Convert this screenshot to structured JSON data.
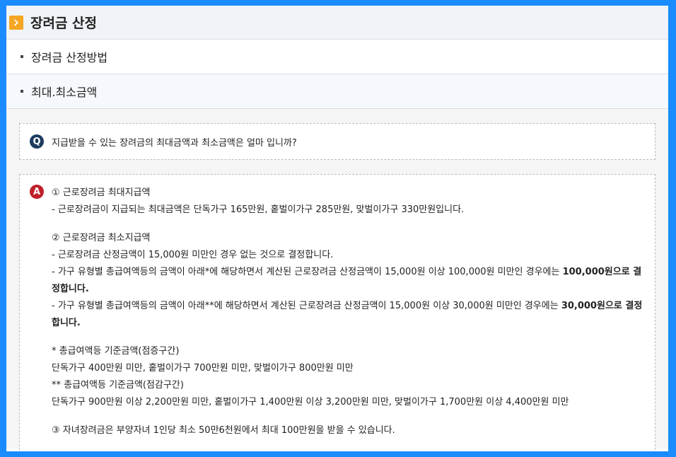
{
  "header": {
    "title": "장려금 산정",
    "icon": "chevron-right-icon",
    "accent": "#f5a623"
  },
  "menu": {
    "items": [
      {
        "label": "장려금 산정방법"
      },
      {
        "label": "최대.최소금액"
      }
    ]
  },
  "question": {
    "badge": "Q",
    "text": "지급받을 수 있는 장려금의 최대금액과 최소금액은 얼마 입니까?"
  },
  "answer": {
    "badge": "A",
    "s1_title": "① 근로장려금 최대지급액",
    "s1_line1": "- 근로장려금이 지급되는 최대금액은 단독가구 165만원, 홑벌이가구 285만원, 맞벌이가구 330만원입니다.",
    "s2_title": "② 근로장려금 최소지급액",
    "s2_line1": "- 근로장려금 산정금액이 15,000원 미만인 경우 없는 것으로 결정합니다.",
    "s2_line2": "- 가구 유형별 총급여액등의 금액이 아래*에 해당하면서 계산된 근로장려금 산정금액이 15,000원 이상 100,000원 미만인 경우에는 ",
    "s2_line2_bold": "100,000원으로 결정합니다.",
    "s2_line3": "- 가구 유형별 총급여액등의 금액이 아래**에 해당하면서 계산된 근로장려금 산정금액이 15,000원 이상 30,000원 미만인 경우에는 ",
    "s2_line3_bold": "30,000원으로 결정합니다.",
    "n1_title": "* 총급여액등 기준금액(점증구간)",
    "n1_line": "단독가구 400만원 미만, 홑벌이가구 700만원 미만, 맞벌이가구 800만원 미만",
    "n2_title": "** 총급여액등 기준금액(점감구간)",
    "n2_line": "단독가구 900만원 이상 2,200만원 미만, 홑벌이가구 1,400만원 이상 3,200만원 미만, 맞벌이가구 1,700만원 이상 4,400만원 미만",
    "s3_line": "③ 자녀장려금은 부양자녀 1인당 최소 50만6천원에서 최대 100만원을 받을 수 있습니다."
  }
}
